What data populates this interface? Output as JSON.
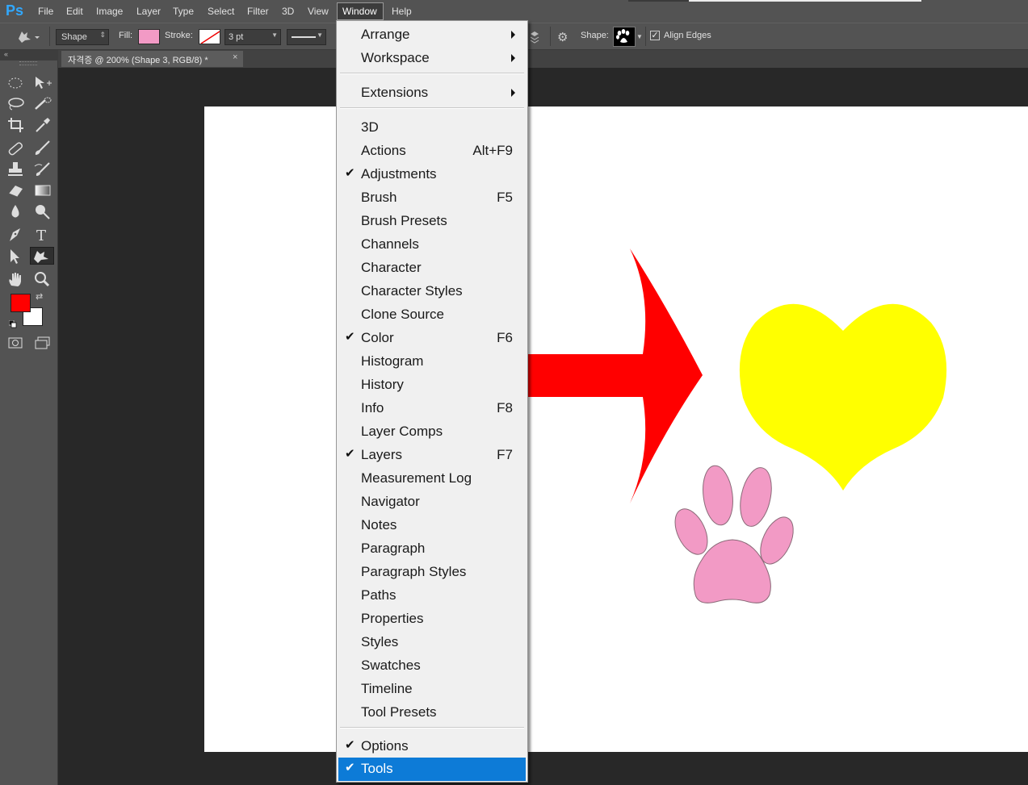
{
  "app": {
    "logo": "Ps"
  },
  "menubar": {
    "items": [
      "File",
      "Edit",
      "Image",
      "Layer",
      "Type",
      "Select",
      "Filter",
      "3D",
      "View",
      "Window",
      "Help"
    ]
  },
  "options": {
    "tool_mode": "Shape",
    "fill_label": "Fill:",
    "stroke_label": "Stroke:",
    "stroke_width": "3 pt",
    "shape_label": "Shape:",
    "align_edges_label": "Align Edges",
    "align_edges_checked": true,
    "fill_color": "#f29ac5"
  },
  "document": {
    "tab_title": "자격증 @ 200% (Shape 3, RGB/8) *",
    "close": "×"
  },
  "colors": {
    "foreground": "#ff0000",
    "background": "#ffffff",
    "arrow": "#ff0000",
    "heart": "#ffff00",
    "paw": "#f29ac5",
    "highlight": "#0d7bd7"
  },
  "window_menu": {
    "submenus": [
      {
        "label": "Arrange",
        "has_submenu": true
      },
      {
        "label": "Workspace",
        "has_submenu": true
      }
    ],
    "extensions": {
      "label": "Extensions",
      "has_submenu": true
    },
    "panels": [
      {
        "label": "3D",
        "shortcut": "",
        "checked": false
      },
      {
        "label": "Actions",
        "shortcut": "Alt+F9",
        "checked": false
      },
      {
        "label": "Adjustments",
        "shortcut": "",
        "checked": true
      },
      {
        "label": "Brush",
        "shortcut": "F5",
        "checked": false
      },
      {
        "label": "Brush Presets",
        "shortcut": "",
        "checked": false
      },
      {
        "label": "Channels",
        "shortcut": "",
        "checked": false
      },
      {
        "label": "Character",
        "shortcut": "",
        "checked": false
      },
      {
        "label": "Character Styles",
        "shortcut": "",
        "checked": false
      },
      {
        "label": "Clone Source",
        "shortcut": "",
        "checked": false
      },
      {
        "label": "Color",
        "shortcut": "F6",
        "checked": true
      },
      {
        "label": "Histogram",
        "shortcut": "",
        "checked": false
      },
      {
        "label": "History",
        "shortcut": "",
        "checked": false
      },
      {
        "label": "Info",
        "shortcut": "F8",
        "checked": false
      },
      {
        "label": "Layer Comps",
        "shortcut": "",
        "checked": false
      },
      {
        "label": "Layers",
        "shortcut": "F7",
        "checked": true
      },
      {
        "label": "Measurement Log",
        "shortcut": "",
        "checked": false
      },
      {
        "label": "Navigator",
        "shortcut": "",
        "checked": false
      },
      {
        "label": "Notes",
        "shortcut": "",
        "checked": false
      },
      {
        "label": "Paragraph",
        "shortcut": "",
        "checked": false
      },
      {
        "label": "Paragraph Styles",
        "shortcut": "",
        "checked": false
      },
      {
        "label": "Paths",
        "shortcut": "",
        "checked": false
      },
      {
        "label": "Properties",
        "shortcut": "",
        "checked": false
      },
      {
        "label": "Styles",
        "shortcut": "",
        "checked": false
      },
      {
        "label": "Swatches",
        "shortcut": "",
        "checked": false
      },
      {
        "label": "Timeline",
        "shortcut": "",
        "checked": false
      },
      {
        "label": "Tool Presets",
        "shortcut": "",
        "checked": false
      }
    ],
    "bottom": [
      {
        "label": "Options",
        "checked": true,
        "highlighted": false
      },
      {
        "label": "Tools",
        "checked": true,
        "highlighted": true
      }
    ],
    "checkmark": "✔"
  }
}
